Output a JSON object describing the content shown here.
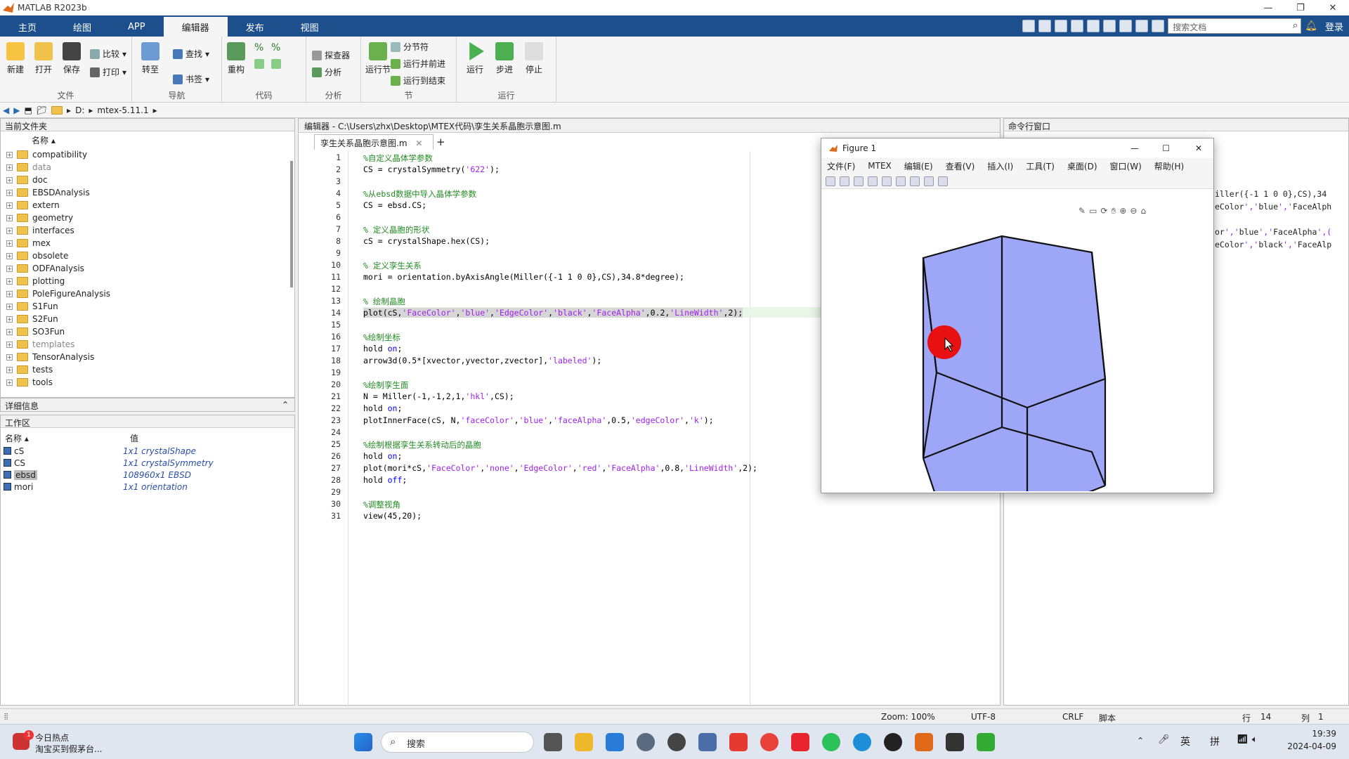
{
  "app": {
    "title": "MATLAB R2023b"
  },
  "tabs": [
    "主页",
    "绘图",
    "APP",
    "编辑器",
    "发布",
    "视图"
  ],
  "search_doc": {
    "placeholder": "搜索文档"
  },
  "login": "登录",
  "ribbon": {
    "file": {
      "label": "文件",
      "new": "新建",
      "open": "打开",
      "save": "保存",
      "compare": "比较",
      "print": "打印"
    },
    "nav": {
      "label": "导航",
      "goto": "转至",
      "find": "查找",
      "bookmark": "书签"
    },
    "code": {
      "label": "代码",
      "refactor": "重构"
    },
    "analyze": {
      "label": "分析",
      "explorer": "探查器",
      "analyze": "分析"
    },
    "section": {
      "label": "节",
      "run_section": "运行节",
      "section_break": "分节符",
      "run_advance": "运行并前进",
      "run_to_end": "运行到结束"
    },
    "run": {
      "label": "运行",
      "run": "运行",
      "step": "步进",
      "stop": "停止"
    }
  },
  "address": {
    "drive": "D:",
    "folder": "mtex-5.11.1"
  },
  "files_panel": {
    "title": "当前文件夹",
    "col_name": "名称",
    "items": [
      "compatibility",
      "data",
      "doc",
      "EBSDAnalysis",
      "extern",
      "geometry",
      "interfaces",
      "mex",
      "obsolete",
      "ODFAnalysis",
      "plotting",
      "PoleFigureAnalysis",
      "S1Fun",
      "S2Fun",
      "SO3Fun",
      "templates",
      "TensorAnalysis",
      "tests",
      "tools"
    ]
  },
  "details": {
    "title": "详细信息"
  },
  "workspace": {
    "title": "工作区",
    "col_name": "名称",
    "col_value": "值",
    "vars": [
      {
        "name": "cS",
        "value": "1x1 crystalShape"
      },
      {
        "name": "CS",
        "value": "1x1 crystalSymmetry"
      },
      {
        "name": "ebsd",
        "value": "108960x1 EBSD"
      },
      {
        "name": "mori",
        "value": "1x1 orientation"
      }
    ]
  },
  "editor": {
    "header": "编辑器 - C:\\Users\\zhx\\Desktop\\MTEX代码\\孪生关系晶胞示意图.m",
    "tab": "孪生关系晶胞示意图.m",
    "lines": [
      "%自定义晶体学参数",
      "CS = crystalSymmetry('622');",
      "",
      "%从ebsd数据中导入晶体学参数",
      "CS = ebsd.CS;",
      "",
      "% 定义晶胞的形状",
      "cS = crystalShape.hex(CS);",
      "",
      "% 定义孪生关系",
      "mori = orientation.byAxisAngle(Miller({-1 1 0 0},CS),34.8*degree);",
      "",
      "% 绘制晶胞",
      "plot(cS,'FaceColor','blue','EdgeColor','black','FaceAlpha',0.2,'LineWidth',2);",
      "",
      "%绘制坐标",
      "hold on;",
      "arrow3d(0.5*[xvector,yvector,zvector],'labeled');",
      "",
      "%绘制孪生面",
      "N = Miller(-1,-1,2,1,'hkl',CS);",
      "hold on;",
      "plotInnerFace(cS, N,'faceColor','blue','faceAlpha',0.5,'edgeColor','k');",
      "",
      "%绘制根据孪生关系转动后的晶胞",
      "hold on;",
      "plot(mori*cS,'FaceColor','none','EdgeColor','red','FaceAlpha',0.8,'LineWidth',2);",
      "hold off;",
      "",
      "%调整视角",
      "view(45,20);"
    ]
  },
  "command_window": {
    "title": "命令行窗口",
    "lines": [
      "iller({-1 1 0 0},CS),34",
      "eColor','blue','FaceAlph",
      "",
      "or','blue','FaceAlpha',(",
      "eColor','black','FaceAlp"
    ]
  },
  "figure": {
    "title": "Figure 1",
    "menu": [
      "文件(F)",
      "MTEX",
      "编辑(E)",
      "查看(V)",
      "插入(I)",
      "工具(T)",
      "桌面(D)",
      "窗口(W)",
      "帮助(H)"
    ],
    "face_color": "#9da6f7"
  },
  "status": {
    "zoom": "Zoom: 100%",
    "encoding": "UTF-8",
    "eol": "CRLF",
    "type": "脚本",
    "row_label": "行",
    "row": "14",
    "col_label": "列",
    "col": "1"
  },
  "taskbar": {
    "news_title": "今日热点",
    "news_sub": "淘宝买到假茅台...",
    "search": "搜索",
    "ime1": "英",
    "ime2": "拼",
    "time": "19:39",
    "date": "2024-04-09",
    "badge": "1"
  },
  "colors": {
    "tab_bar": "#1d4f8c",
    "comment": "#228b22",
    "string": "#a020f0",
    "keyword": "#0000ff"
  }
}
